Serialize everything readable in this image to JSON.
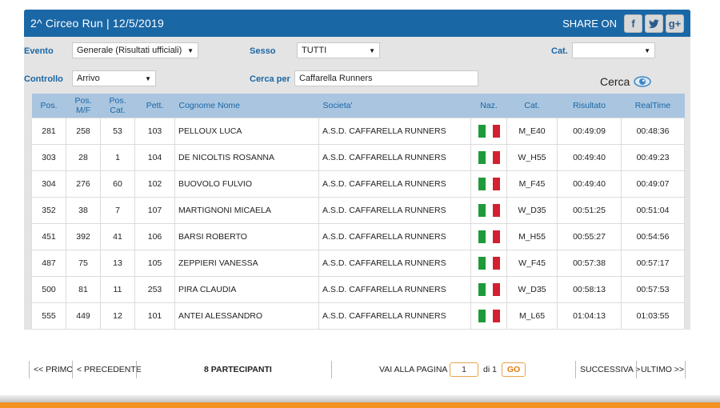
{
  "header": {
    "title": "2^ Circeo Run  |  12/5/2019",
    "share_label": "SHARE ON",
    "share_buttons": [
      "facebook-icon",
      "twitter-icon",
      "google-plus-icon"
    ]
  },
  "filters": {
    "evento_label": "Evento",
    "evento_value": "Generale (Risultati ufficiali)",
    "sesso_label": "Sesso",
    "sesso_value": "TUTTI",
    "cat_label": "Cat.",
    "cat_value": "",
    "controllo_label": "Controllo",
    "controllo_value": "Arrivo",
    "cerca_per_label": "Cerca per",
    "cerca_per_value": "Caffarella Runners",
    "cerca_button": "Cerca"
  },
  "table": {
    "columns": [
      "Pos.",
      "Pos. M/F",
      "Pos. Cat.",
      "Pett.",
      "Cognome Nome",
      "Societa'",
      "Naz.",
      "Cat.",
      "Risultato",
      "RealTime"
    ],
    "rows": [
      [
        "281",
        "258",
        "53",
        "103",
        "PELLOUX LUCA",
        "A.S.D. CAFFARELLA RUNNERS",
        "IT",
        "M_E40",
        "00:49:09",
        "00:48:36"
      ],
      [
        "303",
        "28",
        "1",
        "104",
        "DE NICOLTIS ROSANNA",
        "A.S.D. CAFFARELLA RUNNERS",
        "IT",
        "W_H55",
        "00:49:40",
        "00:49:23"
      ],
      [
        "304",
        "276",
        "60",
        "102",
        "BUOVOLO FULVIO",
        "A.S.D. CAFFARELLA RUNNERS",
        "IT",
        "M_F45",
        "00:49:40",
        "00:49:07"
      ],
      [
        "352",
        "38",
        "7",
        "107",
        "MARTIGNONI MICAELA",
        "A.S.D. CAFFARELLA RUNNERS",
        "IT",
        "W_D35",
        "00:51:25",
        "00:51:04"
      ],
      [
        "451",
        "392",
        "41",
        "106",
        "BARSI ROBERTO",
        "A.S.D. CAFFARELLA RUNNERS",
        "IT",
        "M_H55",
        "00:55:27",
        "00:54:56"
      ],
      [
        "487",
        "75",
        "13",
        "105",
        "ZEPPIERI VANESSA",
        "A.S.D. CAFFARELLA RUNNERS",
        "IT",
        "W_F45",
        "00:57:38",
        "00:57:17"
      ],
      [
        "500",
        "81",
        "11",
        "253",
        "PIRA CLAUDIA",
        "A.S.D. CAFFARELLA RUNNERS",
        "IT",
        "W_D35",
        "00:58:13",
        "00:57:53"
      ],
      [
        "555",
        "449",
        "12",
        "101",
        "ANTEI ALESSANDRO",
        "A.S.D. CAFFARELLA RUNNERS",
        "IT",
        "M_L65",
        "01:04:13",
        "01:03:55"
      ]
    ],
    "flag_colors": [
      "#1e9a3a",
      "#ffffff",
      "#d32030"
    ]
  },
  "pager": {
    "first": "<< PRIMO",
    "prev": "< PRECEDENTE",
    "count": "8 PARTECIPANTI",
    "goto_label": "VAI ALLA PAGINA",
    "page": "1",
    "of": "di 1",
    "go": "GO",
    "next": "SUCCESSIVA >",
    "last": "ULTIMO >>"
  },
  "colors": {
    "accent": "#1a67a6",
    "orange": "#f39121",
    "header_row": "#a9c5df"
  }
}
